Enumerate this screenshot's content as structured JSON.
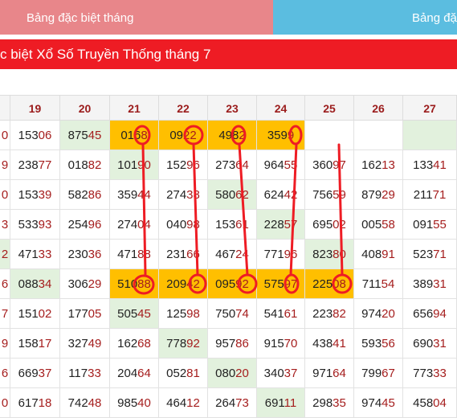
{
  "tabs": [
    {
      "label": "Bảng đặc biệt tháng"
    },
    {
      "label": "Bảng đặ"
    }
  ],
  "title": "c biệt Xổ Số Truyền Thống tháng 7",
  "days": [
    "",
    "19",
    "20",
    "21",
    "22",
    "23",
    "24",
    "25",
    "26",
    "27"
  ],
  "rows": [
    {
      "cells": [
        [
          "",
          "0"
        ],
        [
          "153",
          "06"
        ],
        [
          "875",
          "45"
        ],
        [
          "016",
          "8"
        ],
        [
          "09",
          "22"
        ],
        [
          "498",
          "2"
        ],
        [
          "359",
          "9"
        ],
        [
          "",
          ""
        ],
        [
          "",
          ""
        ],
        [
          "",
          ""
        ]
      ],
      "styles": [
        "",
        "",
        "green",
        "orange",
        "orange",
        "orange",
        "orange",
        "",
        "",
        "green"
      ]
    },
    {
      "cells": [
        [
          "",
          "9"
        ],
        [
          "238",
          "77"
        ],
        [
          "018",
          "82"
        ],
        [
          "101",
          "90"
        ],
        [
          "152",
          "96"
        ],
        [
          "273",
          "64"
        ],
        [
          "964",
          "55"
        ],
        [
          "360",
          "97"
        ],
        [
          "162",
          "13"
        ],
        [
          "133",
          "41"
        ]
      ],
      "styles": [
        "",
        "",
        "",
        "green",
        "",
        "",
        "",
        "",
        "",
        ""
      ]
    },
    {
      "cells": [
        [
          "",
          "0"
        ],
        [
          "153",
          "39"
        ],
        [
          "582",
          "86"
        ],
        [
          "359",
          "44"
        ],
        [
          "274",
          "38"
        ],
        [
          "580",
          "62"
        ],
        [
          "624",
          "42"
        ],
        [
          "756",
          "59"
        ],
        [
          "879",
          "29"
        ],
        [
          "211",
          "71"
        ]
      ],
      "styles": [
        "",
        "",
        "",
        "",
        "",
        "green",
        "",
        "",
        "",
        ""
      ]
    },
    {
      "cells": [
        [
          "",
          "3"
        ],
        [
          "533",
          "93"
        ],
        [
          "254",
          "96"
        ],
        [
          "274",
          "04"
        ],
        [
          "040",
          "98"
        ],
        [
          "153",
          "61"
        ],
        [
          "228",
          "57"
        ],
        [
          "695",
          "02"
        ],
        [
          "005",
          "58"
        ],
        [
          "091",
          "55"
        ]
      ],
      "styles": [
        "",
        "",
        "",
        "",
        "",
        "",
        "green",
        "",
        "",
        ""
      ]
    },
    {
      "cells": [
        [
          "",
          "2"
        ],
        [
          "471",
          "33"
        ],
        [
          "230",
          "36"
        ],
        [
          "471",
          "88"
        ],
        [
          "231",
          "66"
        ],
        [
          "467",
          "24"
        ],
        [
          "771",
          "96"
        ],
        [
          "823",
          "80"
        ],
        [
          "408",
          "91"
        ],
        [
          "523",
          "71"
        ]
      ],
      "styles": [
        "green",
        "",
        "",
        "",
        "",
        "",
        "",
        "green",
        "",
        ""
      ]
    },
    {
      "cells": [
        [
          "",
          "6"
        ],
        [
          "088",
          "34"
        ],
        [
          "306",
          "29"
        ],
        [
          "510",
          "88"
        ],
        [
          "209",
          "42"
        ],
        [
          "095",
          "92"
        ],
        [
          "575",
          "97"
        ],
        [
          "225",
          "08"
        ],
        [
          "711",
          "54"
        ],
        [
          "389",
          "31"
        ]
      ],
      "styles": [
        "",
        "green",
        "",
        "orange",
        "orange",
        "orange",
        "orange",
        "orange",
        "",
        ""
      ]
    },
    {
      "cells": [
        [
          "",
          "7"
        ],
        [
          "151",
          "02"
        ],
        [
          "177",
          "05"
        ],
        [
          "505",
          "45"
        ],
        [
          "125",
          "98"
        ],
        [
          "750",
          "74"
        ],
        [
          "541",
          "61"
        ],
        [
          "223",
          "82"
        ],
        [
          "974",
          "20"
        ],
        [
          "656",
          "94"
        ]
      ],
      "styles": [
        "",
        "",
        "",
        "green",
        "",
        "",
        "",
        "",
        "",
        ""
      ]
    },
    {
      "cells": [
        [
          "",
          "9"
        ],
        [
          "158",
          "17"
        ],
        [
          "327",
          "49"
        ],
        [
          "162",
          "68"
        ],
        [
          "778",
          "92"
        ],
        [
          "957",
          "86"
        ],
        [
          "915",
          "70"
        ],
        [
          "438",
          "41"
        ],
        [
          "593",
          "56"
        ],
        [
          "690",
          "31"
        ]
      ],
      "styles": [
        "",
        "",
        "",
        "",
        "green",
        "",
        "",
        "",
        "",
        ""
      ]
    },
    {
      "cells": [
        [
          "",
          "6"
        ],
        [
          "669",
          "37"
        ],
        [
          "117",
          "33"
        ],
        [
          "204",
          "64"
        ],
        [
          "052",
          "81"
        ],
        [
          "080",
          "20"
        ],
        [
          "340",
          "37"
        ],
        [
          "971",
          "64"
        ],
        [
          "799",
          "67"
        ],
        [
          "773",
          "33"
        ]
      ],
      "styles": [
        "",
        "",
        "",
        "",
        "",
        "green",
        "",
        "",
        "",
        ""
      ]
    },
    {
      "cells": [
        [
          "",
          "0"
        ],
        [
          "617",
          "18"
        ],
        [
          "742",
          "48"
        ],
        [
          "985",
          "40"
        ],
        [
          "464",
          "12"
        ],
        [
          "264",
          "73"
        ],
        [
          "691",
          "11"
        ],
        [
          "298",
          "35"
        ],
        [
          "974",
          "45"
        ],
        [
          "458",
          "04"
        ]
      ],
      "styles": [
        "",
        "",
        "",
        "",
        "",
        "",
        "green",
        "",
        "",
        ""
      ]
    }
  ],
  "colors": {
    "tab1": "#e8868a",
    "tab2": "#5bbde0",
    "title_bar": "#ee1c24",
    "highlight": "#ffbf00",
    "hit": "#e2f1dd",
    "marker": "#ee1c24"
  }
}
